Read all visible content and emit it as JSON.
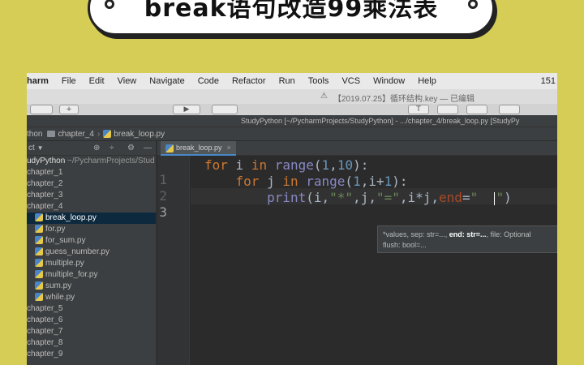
{
  "banner": {
    "title": "break语句改造99乘法表"
  },
  "menubar": {
    "app_name": "harm",
    "items": [
      "File",
      "Edit",
      "View",
      "Navigate",
      "Code",
      "Refactor",
      "Run",
      "Tools",
      "VCS",
      "Window",
      "Help"
    ],
    "right_text": "151"
  },
  "system_titlebar": {
    "title": "【2019.07.25】循环结构.key — 已编辑"
  },
  "ide_titlebar": {
    "title": "StudyPython [~/PycharmProjects/StudyPython] - .../chapter_4/break_loop.py [StudyPy"
  },
  "navbar": {
    "crumbs": [
      "thon",
      "chapter_4",
      "break_loop.py"
    ]
  },
  "sidebar": {
    "header": "ct",
    "root": {
      "name": "udyPython",
      "path": "~/PycharmProjects/Stud"
    },
    "items": [
      {
        "label": "chapter_1",
        "kind": "folder"
      },
      {
        "label": "chapter_2",
        "kind": "folder"
      },
      {
        "label": "chapter_3",
        "kind": "folder"
      },
      {
        "label": "chapter_4",
        "kind": "folder"
      },
      {
        "label": "break_loop.py",
        "kind": "file",
        "selected": true
      },
      {
        "label": "for.py",
        "kind": "file"
      },
      {
        "label": "for_sum.py",
        "kind": "file"
      },
      {
        "label": "guess_number.py",
        "kind": "file"
      },
      {
        "label": "multiple.py",
        "kind": "file"
      },
      {
        "label": "multiple_for.py",
        "kind": "file"
      },
      {
        "label": "sum.py",
        "kind": "file"
      },
      {
        "label": "while.py",
        "kind": "file"
      },
      {
        "label": "chapter_5",
        "kind": "folder"
      },
      {
        "label": "chapter_6",
        "kind": "folder"
      },
      {
        "label": "chapter_7",
        "kind": "folder"
      },
      {
        "label": "chapter_8",
        "kind": "folder"
      },
      {
        "label": "chapter_9",
        "kind": "folder"
      }
    ]
  },
  "editor": {
    "tab_label": "break_loop.py",
    "line_numbers": [
      "1",
      "2",
      "3"
    ],
    "current_line": 3,
    "code_lines": [
      "for i in range(1,10):",
      "    for j in range(1,i+1):",
      "        print(i,\"*\",j,\"=\",i*j,end=\"  \")"
    ]
  },
  "param_hint": {
    "line1_pre": "*values, sep: str=..., ",
    "line1_bold": "end: str=...",
    "line1_post": ", file: Optional",
    "line2": "flush: bool=..."
  },
  "colors": {
    "background": "#d5cd55",
    "editor_bg": "#2b2b2b",
    "keyword": "#cc7832",
    "string": "#6a8759",
    "number": "#6897bb",
    "builtin": "#8888c6"
  }
}
